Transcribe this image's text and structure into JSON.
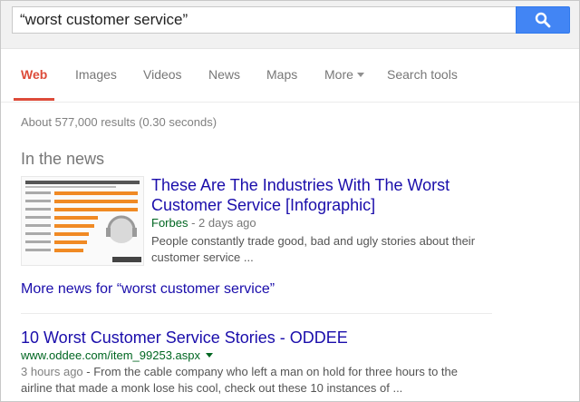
{
  "search": {
    "query": "“worst customer service”"
  },
  "tabs": [
    {
      "label": "Web"
    },
    {
      "label": "Images"
    },
    {
      "label": "Videos"
    },
    {
      "label": "News"
    },
    {
      "label": "Maps"
    },
    {
      "label": "More"
    },
    {
      "label": "Search tools"
    }
  ],
  "stats": "About 577,000 results (0.30 seconds)",
  "news": {
    "heading": "In the news",
    "thumbnail_icon": "infographic-thumbnail",
    "title_line1": "These Are The Industries With The Worst",
    "title_line2": "Customer Service [Infographic]",
    "source": "Forbes",
    "separator": " - ",
    "age": "2 days ago",
    "snippet_line1": "People constantly trade good, bad and ugly stories about their",
    "snippet_line2": "customer service ...",
    "more_link": "More news for “worst customer service”"
  },
  "results": [
    {
      "title": "10 Worst Customer Service Stories - ODDEE",
      "url": "www.oddee.com/item_99253.aspx",
      "age": "3 hours ago",
      "snippet_line1_rest": " - From the cable company who left a man on hold for three hours to the",
      "snippet_line2": "airline that made a monk lose his cool, check out these 10 instances of ..."
    }
  ],
  "colors": {
    "accent_red": "#dd4b39",
    "link_blue": "#1a0dab",
    "url_green": "#006621",
    "search_button_blue": "#4285f4"
  }
}
